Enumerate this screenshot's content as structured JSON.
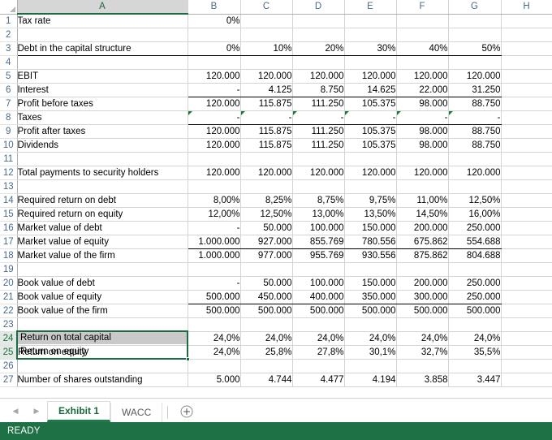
{
  "app": {
    "status_text": "READY"
  },
  "columns": [
    {
      "label": "A",
      "selected": true
    },
    {
      "label": "B",
      "selected": false
    },
    {
      "label": "C",
      "selected": false
    },
    {
      "label": "D",
      "selected": false
    },
    {
      "label": "E",
      "selected": false
    },
    {
      "label": "F",
      "selected": false
    },
    {
      "label": "G",
      "selected": false
    },
    {
      "label": "H",
      "selected": false
    }
  ],
  "selection": {
    "range": "A24:A25",
    "active_cell": "A24",
    "active_cell_value": "Return on total capital",
    "second_cell_value": "Return on equity"
  },
  "rows": [
    {
      "n": "1",
      "selected": false,
      "cells": [
        "Tax rate",
        "0%",
        "",
        "",
        "",
        "",
        "",
        ""
      ]
    },
    {
      "n": "2",
      "selected": false,
      "cells": [
        "",
        "",
        "",
        "",
        "",
        "",
        "",
        ""
      ]
    },
    {
      "n": "3",
      "selected": false,
      "cells": [
        "Debt in the capital structure",
        "0%",
        "10%",
        "20%",
        "30%",
        "40%",
        "50%",
        ""
      ]
    },
    {
      "n": "4",
      "selected": false,
      "cells": [
        "",
        "",
        "",
        "",
        "",
        "",
        "",
        ""
      ]
    },
    {
      "n": "5",
      "selected": false,
      "cells": [
        "EBIT",
        "120.000",
        "120.000",
        "120.000",
        "120.000",
        "120.000",
        "120.000",
        ""
      ]
    },
    {
      "n": "6",
      "selected": false,
      "cells": [
        "Interest",
        "-",
        "4.125",
        "8.750",
        "14.625",
        "22.000",
        "31.250",
        ""
      ]
    },
    {
      "n": "7",
      "selected": false,
      "cells": [
        "Profit before taxes",
        "120.000",
        "115.875",
        "111.250",
        "105.375",
        "98.000",
        "88.750",
        ""
      ]
    },
    {
      "n": "8",
      "selected": false,
      "cells": [
        "Taxes",
        "-",
        "-",
        "-",
        "-",
        "-",
        "-",
        ""
      ]
    },
    {
      "n": "9",
      "selected": false,
      "cells": [
        "Profit after taxes",
        "120.000",
        "115.875",
        "111.250",
        "105.375",
        "98.000",
        "88.750",
        ""
      ]
    },
    {
      "n": "10",
      "selected": false,
      "cells": [
        "Dividends",
        "120.000",
        "115.875",
        "111.250",
        "105.375",
        "98.000",
        "88.750",
        ""
      ]
    },
    {
      "n": "11",
      "selected": false,
      "cells": [
        "",
        "",
        "",
        "",
        "",
        "",
        "",
        ""
      ]
    },
    {
      "n": "12",
      "selected": false,
      "cells": [
        "Total payments to security holders",
        "120.000",
        "120.000",
        "120.000",
        "120.000",
        "120.000",
        "120.000",
        ""
      ]
    },
    {
      "n": "13",
      "selected": false,
      "cells": [
        "",
        "",
        "",
        "",
        "",
        "",
        "",
        ""
      ]
    },
    {
      "n": "14",
      "selected": false,
      "cells": [
        "Required return on debt",
        "8,00%",
        "8,25%",
        "8,75%",
        "9,75%",
        "11,00%",
        "12,50%",
        ""
      ]
    },
    {
      "n": "15",
      "selected": false,
      "cells": [
        "Required return on equity",
        "12,00%",
        "12,50%",
        "13,00%",
        "13,50%",
        "14,50%",
        "16,00%",
        ""
      ]
    },
    {
      "n": "16",
      "selected": false,
      "cells": [
        "Market value of debt",
        "-",
        "50.000",
        "100.000",
        "150.000",
        "200.000",
        "250.000",
        ""
      ]
    },
    {
      "n": "17",
      "selected": false,
      "cells": [
        "Market value of equity",
        "1.000.000",
        "927.000",
        "855.769",
        "780.556",
        "675.862",
        "554.688",
        ""
      ]
    },
    {
      "n": "18",
      "selected": false,
      "cells": [
        "Market value of the firm",
        "1.000.000",
        "977.000",
        "955.769",
        "930.556",
        "875.862",
        "804.688",
        ""
      ]
    },
    {
      "n": "19",
      "selected": false,
      "cells": [
        "",
        "",
        "",
        "",
        "",
        "",
        "",
        ""
      ]
    },
    {
      "n": "20",
      "selected": false,
      "cells": [
        "Book value of debt",
        "-",
        "50.000",
        "100.000",
        "150.000",
        "200.000",
        "250.000",
        ""
      ]
    },
    {
      "n": "21",
      "selected": false,
      "cells": [
        "Book value of equity",
        "500.000",
        "450.000",
        "400.000",
        "350.000",
        "300.000",
        "250.000",
        ""
      ]
    },
    {
      "n": "22",
      "selected": false,
      "cells": [
        "Book value of the firm",
        "500.000",
        "500.000",
        "500.000",
        "500.000",
        "500.000",
        "500.000",
        ""
      ]
    },
    {
      "n": "23",
      "selected": false,
      "cells": [
        "",
        "",
        "",
        "",
        "",
        "",
        "",
        ""
      ]
    },
    {
      "n": "24",
      "selected": true,
      "cells": [
        "Return on total capital",
        "24,0%",
        "24,0%",
        "24,0%",
        "24,0%",
        "24,0%",
        "24,0%",
        ""
      ]
    },
    {
      "n": "25",
      "selected": true,
      "cells": [
        "Return on equity",
        "24,0%",
        "25,8%",
        "27,8%",
        "30,1%",
        "32,7%",
        "35,5%",
        ""
      ]
    },
    {
      "n": "26",
      "selected": false,
      "cells": [
        "",
        "",
        "",
        "",
        "",
        "",
        "",
        ""
      ]
    },
    {
      "n": "27",
      "selected": false,
      "cells": [
        "Number of shares outstanding",
        "5.000",
        "4.744",
        "4.477",
        "4.194",
        "3.858",
        "3.447",
        ""
      ]
    }
  ],
  "tabbar": {
    "prev_arrow": "◀",
    "next_arrow": "▶",
    "sheets": [
      {
        "label": "Exhibit 1",
        "active": true
      },
      {
        "label": "WACC",
        "active": false
      }
    ],
    "add_sheet_label": "+"
  }
}
